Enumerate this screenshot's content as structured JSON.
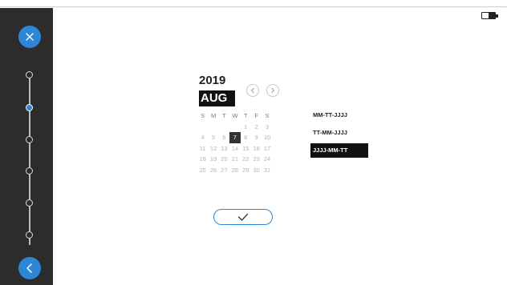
{
  "sidebar": {
    "close_icon": "close-icon",
    "back_icon": "chevron-left-icon",
    "steps": [
      {
        "state": "done"
      },
      {
        "state": "active"
      },
      {
        "state": "pending"
      },
      {
        "state": "pending"
      },
      {
        "state": "pending"
      },
      {
        "state": "pending"
      }
    ]
  },
  "status": {
    "battery_icon": "battery-icon"
  },
  "calendar": {
    "year": "2019",
    "month": "AUG",
    "weekdays": [
      "S",
      "M",
      "T",
      "W",
      "T",
      "F",
      "S"
    ],
    "weeks": [
      [
        "",
        "",
        "",
        "",
        "1",
        "2",
        "3"
      ],
      [
        "4",
        "5",
        "6",
        "7",
        "8",
        "9",
        "10"
      ],
      [
        "11",
        "12",
        "13",
        "14",
        "15",
        "16",
        "17"
      ],
      [
        "18",
        "19",
        "20",
        "21",
        "22",
        "23",
        "24"
      ],
      [
        "25",
        "26",
        "27",
        "28",
        "29",
        "30",
        "31"
      ]
    ],
    "selected_day": "7",
    "prev_icon": "chevron-left-icon",
    "next_icon": "chevron-right-icon"
  },
  "formats": {
    "options": [
      "MM-TT-JJJJ",
      "TT-MM-JJJJ",
      "JJJJ-MM-TT"
    ],
    "selected": "JJJJ-MM-TT"
  },
  "confirm": {
    "icon": "checkmark-icon"
  },
  "colors": {
    "accent": "#2e86d6",
    "sidebar": "#2c2c2c",
    "selected": "#111111"
  }
}
